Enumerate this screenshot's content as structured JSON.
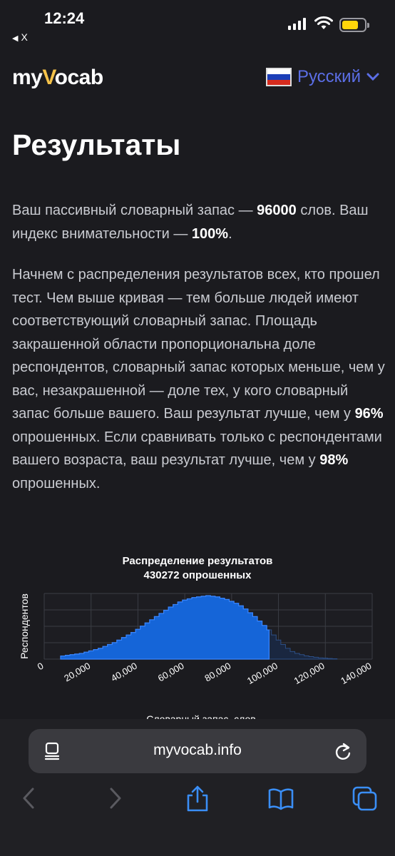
{
  "status_bar": {
    "time": "12:24",
    "back_app": "X"
  },
  "header": {
    "logo_prefix": "my",
    "logo_v": "V",
    "logo_suffix": "ocab",
    "language": "Русский"
  },
  "page_title": "Результаты",
  "summary": {
    "part1": "Ваш пассивный словарный запас — ",
    "vocab": "96000",
    "part2": " слов. Ваш индекс внимательности — ",
    "attention": "100%",
    "part3": "."
  },
  "explanation": {
    "part1": "Начнем с распределения результатов всех, кто прошел тест. Чем выше кривая — тем больше людей имеют соответствующий словарный запас. Площадь закрашенной области пропорциональна доле респондентов, словарный запас которых меньше, чем у вас, незакрашенной — доле тех, у кого словарный запас больше вашего. Ваш результат лучше, чем у ",
    "pct_all": "96%",
    "part2": " опрошенных. Если сравнивать только с респондентами вашего возраста, ваш результат лучше, чем у ",
    "pct_age": "98%",
    "part3": " опрошенных."
  },
  "chart_data": {
    "type": "area",
    "title": "Распределение результатов",
    "subtitle": "430272 опрошенных",
    "xlabel": "Словарный запас, слов",
    "ylabel": "Респондентов",
    "xlim": [
      0,
      140000
    ],
    "x_ticks": [
      "0",
      "20,000",
      "40,000",
      "60,000",
      "80,000",
      "100,000",
      "120,000",
      "140,000"
    ],
    "grid": true,
    "user_value": 96000,
    "fill_color": "#1565d8",
    "x": [
      8000,
      10000,
      12000,
      14000,
      16000,
      18000,
      20000,
      22000,
      24000,
      26000,
      28000,
      30000,
      32000,
      34000,
      36000,
      38000,
      40000,
      42000,
      44000,
      46000,
      48000,
      50000,
      52000,
      54000,
      56000,
      58000,
      60000,
      62000,
      64000,
      66000,
      68000,
      70000,
      72000,
      74000,
      76000,
      78000,
      80000,
      82000,
      84000,
      86000,
      88000,
      90000,
      92000,
      94000,
      96000,
      98000,
      100000,
      102000,
      104000,
      106000,
      108000,
      110000,
      112000,
      114000,
      116000,
      118000,
      120000,
      122000,
      124000
    ],
    "y": [
      0.05,
      0.06,
      0.07,
      0.08,
      0.09,
      0.11,
      0.13,
      0.15,
      0.17,
      0.2,
      0.23,
      0.26,
      0.3,
      0.34,
      0.38,
      0.42,
      0.47,
      0.52,
      0.57,
      0.62,
      0.67,
      0.72,
      0.77,
      0.82,
      0.86,
      0.9,
      0.93,
      0.95,
      0.97,
      0.98,
      0.99,
      1.0,
      0.99,
      0.98,
      0.96,
      0.94,
      0.91,
      0.88,
      0.84,
      0.79,
      0.73,
      0.67,
      0.6,
      0.53,
      0.46,
      0.38,
      0.3,
      0.23,
      0.17,
      0.12,
      0.09,
      0.07,
      0.05,
      0.04,
      0.03,
      0.02,
      0.015,
      0.01,
      0.005
    ]
  },
  "browser": {
    "url": "myvocab.info"
  }
}
